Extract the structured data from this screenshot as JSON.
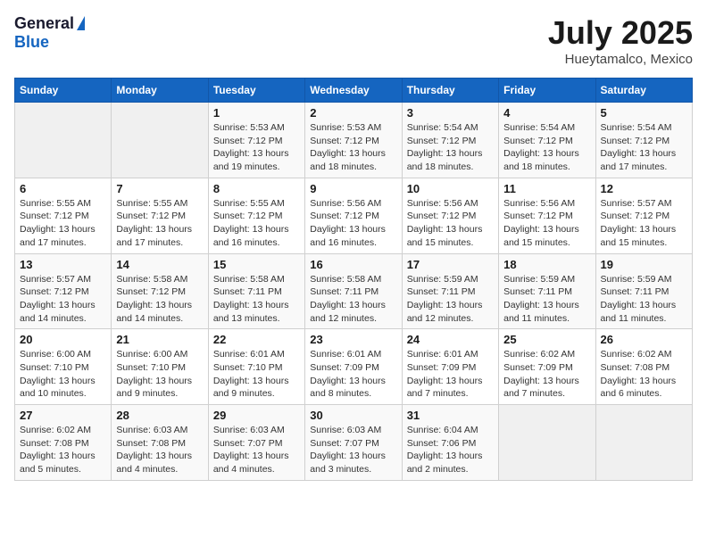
{
  "header": {
    "logo_general": "General",
    "logo_blue": "Blue",
    "title": "July 2025",
    "location": "Hueytamalco, Mexico"
  },
  "weekdays": [
    "Sunday",
    "Monday",
    "Tuesday",
    "Wednesday",
    "Thursday",
    "Friday",
    "Saturday"
  ],
  "weeks": [
    [
      {
        "day": "",
        "sunrise": "",
        "sunset": "",
        "daylight": ""
      },
      {
        "day": "",
        "sunrise": "",
        "sunset": "",
        "daylight": ""
      },
      {
        "day": "1",
        "sunrise": "Sunrise: 5:53 AM",
        "sunset": "Sunset: 7:12 PM",
        "daylight": "Daylight: 13 hours and 19 minutes."
      },
      {
        "day": "2",
        "sunrise": "Sunrise: 5:53 AM",
        "sunset": "Sunset: 7:12 PM",
        "daylight": "Daylight: 13 hours and 18 minutes."
      },
      {
        "day": "3",
        "sunrise": "Sunrise: 5:54 AM",
        "sunset": "Sunset: 7:12 PM",
        "daylight": "Daylight: 13 hours and 18 minutes."
      },
      {
        "day": "4",
        "sunrise": "Sunrise: 5:54 AM",
        "sunset": "Sunset: 7:12 PM",
        "daylight": "Daylight: 13 hours and 18 minutes."
      },
      {
        "day": "5",
        "sunrise": "Sunrise: 5:54 AM",
        "sunset": "Sunset: 7:12 PM",
        "daylight": "Daylight: 13 hours and 17 minutes."
      }
    ],
    [
      {
        "day": "6",
        "sunrise": "Sunrise: 5:55 AM",
        "sunset": "Sunset: 7:12 PM",
        "daylight": "Daylight: 13 hours and 17 minutes."
      },
      {
        "day": "7",
        "sunrise": "Sunrise: 5:55 AM",
        "sunset": "Sunset: 7:12 PM",
        "daylight": "Daylight: 13 hours and 17 minutes."
      },
      {
        "day": "8",
        "sunrise": "Sunrise: 5:55 AM",
        "sunset": "Sunset: 7:12 PM",
        "daylight": "Daylight: 13 hours and 16 minutes."
      },
      {
        "day": "9",
        "sunrise": "Sunrise: 5:56 AM",
        "sunset": "Sunset: 7:12 PM",
        "daylight": "Daylight: 13 hours and 16 minutes."
      },
      {
        "day": "10",
        "sunrise": "Sunrise: 5:56 AM",
        "sunset": "Sunset: 7:12 PM",
        "daylight": "Daylight: 13 hours and 15 minutes."
      },
      {
        "day": "11",
        "sunrise": "Sunrise: 5:56 AM",
        "sunset": "Sunset: 7:12 PM",
        "daylight": "Daylight: 13 hours and 15 minutes."
      },
      {
        "day": "12",
        "sunrise": "Sunrise: 5:57 AM",
        "sunset": "Sunset: 7:12 PM",
        "daylight": "Daylight: 13 hours and 15 minutes."
      }
    ],
    [
      {
        "day": "13",
        "sunrise": "Sunrise: 5:57 AM",
        "sunset": "Sunset: 7:12 PM",
        "daylight": "Daylight: 13 hours and 14 minutes."
      },
      {
        "day": "14",
        "sunrise": "Sunrise: 5:58 AM",
        "sunset": "Sunset: 7:12 PM",
        "daylight": "Daylight: 13 hours and 14 minutes."
      },
      {
        "day": "15",
        "sunrise": "Sunrise: 5:58 AM",
        "sunset": "Sunset: 7:11 PM",
        "daylight": "Daylight: 13 hours and 13 minutes."
      },
      {
        "day": "16",
        "sunrise": "Sunrise: 5:58 AM",
        "sunset": "Sunset: 7:11 PM",
        "daylight": "Daylight: 13 hours and 12 minutes."
      },
      {
        "day": "17",
        "sunrise": "Sunrise: 5:59 AM",
        "sunset": "Sunset: 7:11 PM",
        "daylight": "Daylight: 13 hours and 12 minutes."
      },
      {
        "day": "18",
        "sunrise": "Sunrise: 5:59 AM",
        "sunset": "Sunset: 7:11 PM",
        "daylight": "Daylight: 13 hours and 11 minutes."
      },
      {
        "day": "19",
        "sunrise": "Sunrise: 5:59 AM",
        "sunset": "Sunset: 7:11 PM",
        "daylight": "Daylight: 13 hours and 11 minutes."
      }
    ],
    [
      {
        "day": "20",
        "sunrise": "Sunrise: 6:00 AM",
        "sunset": "Sunset: 7:10 PM",
        "daylight": "Daylight: 13 hours and 10 minutes."
      },
      {
        "day": "21",
        "sunrise": "Sunrise: 6:00 AM",
        "sunset": "Sunset: 7:10 PM",
        "daylight": "Daylight: 13 hours and 9 minutes."
      },
      {
        "day": "22",
        "sunrise": "Sunrise: 6:01 AM",
        "sunset": "Sunset: 7:10 PM",
        "daylight": "Daylight: 13 hours and 9 minutes."
      },
      {
        "day": "23",
        "sunrise": "Sunrise: 6:01 AM",
        "sunset": "Sunset: 7:09 PM",
        "daylight": "Daylight: 13 hours and 8 minutes."
      },
      {
        "day": "24",
        "sunrise": "Sunrise: 6:01 AM",
        "sunset": "Sunset: 7:09 PM",
        "daylight": "Daylight: 13 hours and 7 minutes."
      },
      {
        "day": "25",
        "sunrise": "Sunrise: 6:02 AM",
        "sunset": "Sunset: 7:09 PM",
        "daylight": "Daylight: 13 hours and 7 minutes."
      },
      {
        "day": "26",
        "sunrise": "Sunrise: 6:02 AM",
        "sunset": "Sunset: 7:08 PM",
        "daylight": "Daylight: 13 hours and 6 minutes."
      }
    ],
    [
      {
        "day": "27",
        "sunrise": "Sunrise: 6:02 AM",
        "sunset": "Sunset: 7:08 PM",
        "daylight": "Daylight: 13 hours and 5 minutes."
      },
      {
        "day": "28",
        "sunrise": "Sunrise: 6:03 AM",
        "sunset": "Sunset: 7:08 PM",
        "daylight": "Daylight: 13 hours and 4 minutes."
      },
      {
        "day": "29",
        "sunrise": "Sunrise: 6:03 AM",
        "sunset": "Sunset: 7:07 PM",
        "daylight": "Daylight: 13 hours and 4 minutes."
      },
      {
        "day": "30",
        "sunrise": "Sunrise: 6:03 AM",
        "sunset": "Sunset: 7:07 PM",
        "daylight": "Daylight: 13 hours and 3 minutes."
      },
      {
        "day": "31",
        "sunrise": "Sunrise: 6:04 AM",
        "sunset": "Sunset: 7:06 PM",
        "daylight": "Daylight: 13 hours and 2 minutes."
      },
      {
        "day": "",
        "sunrise": "",
        "sunset": "",
        "daylight": ""
      },
      {
        "day": "",
        "sunrise": "",
        "sunset": "",
        "daylight": ""
      }
    ]
  ]
}
